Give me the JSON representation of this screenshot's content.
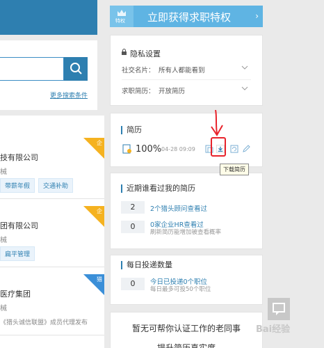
{
  "search": {
    "more_conditions": "更多搜索条件"
  },
  "jobs": [
    {
      "company": "技有限公司",
      "meta": "械",
      "tags": [
        "带薪年假",
        "交通补助"
      ],
      "corner": "企",
      "corner_color": "#f5b220"
    },
    {
      "company": "团有限公司",
      "meta": "械",
      "tags": [
        "扁平管理"
      ],
      "corner": "企",
      "corner_color": "#f5b220"
    },
    {
      "company": "医疗集团",
      "meta": "械",
      "footer": "《猎头诚信联盟》成员代理发布",
      "corner": "猎",
      "corner_color": "#3b8fd8"
    }
  ],
  "vip": {
    "badge": "特权",
    "title": "立即获得求职特权"
  },
  "privacy": {
    "title": "隐私设置",
    "rows": [
      {
        "key": "社交名片：",
        "value": "所有人都能看到"
      },
      {
        "key": "求职简历：",
        "value": "开放简历"
      }
    ]
  },
  "resume": {
    "title": "简历",
    "percent": "100%",
    "date": "04-28 09:09",
    "download_tooltip": "下载简历"
  },
  "viewers": {
    "title": "近期谁看过我的简历",
    "items": [
      {
        "count": "2",
        "text": "2个猎头顾问查看过",
        "sub": ""
      },
      {
        "count": "0",
        "text": "0家企业HR查看过",
        "sub": "刷新简历能增加被查看概率"
      }
    ]
  },
  "daily": {
    "title": "每日投递数量",
    "count": "0",
    "text": "今日已投递0个职位",
    "sub": "每日最多可投50个职位"
  },
  "colleague": {
    "line1": "暂无可帮你认证工作的老同事",
    "line2": "提升简历真实度"
  },
  "watermark": "Bai经验",
  "colors": {
    "accent": "#2e7fb0",
    "vip": "#5fb4e3",
    "annotation": "#e8232b"
  },
  "icons": [
    "search-icon",
    "lock-icon",
    "chevron-down-icon",
    "resume-icon",
    "preview-icon",
    "download-icon",
    "refresh-icon",
    "edit-icon",
    "crown-icon",
    "chat-icon"
  ]
}
